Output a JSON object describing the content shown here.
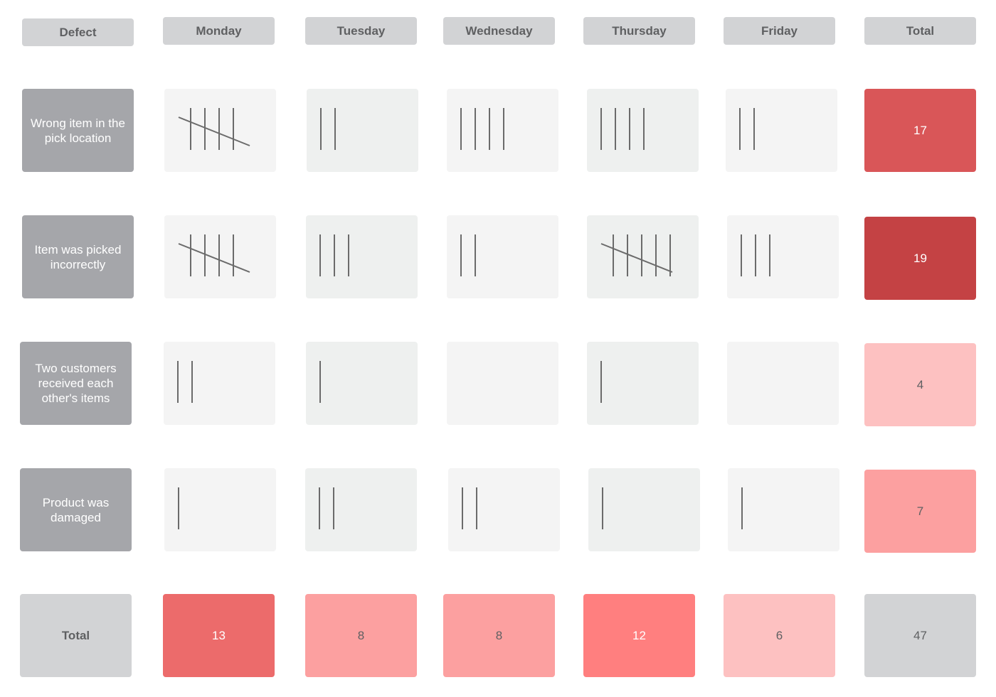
{
  "header": {
    "defect_label": "Defect",
    "days": [
      "Monday",
      "Tuesday",
      "Wednesday",
      "Thursday",
      "Friday"
    ],
    "total_label": "Total"
  },
  "rows": [
    {
      "defect": "Wrong item in the pick location",
      "counts": [
        5,
        2,
        4,
        4,
        2
      ],
      "total": "17",
      "total_color": "#d95658",
      "total_text_color": "#ffffff"
    },
    {
      "defect": "Item was picked incorrectly",
      "counts": [
        5,
        3,
        2,
        6,
        3
      ],
      "total": "19",
      "total_color": "#c44244",
      "total_text_color": "#ffffff"
    },
    {
      "defect": "Two customers received each other's items",
      "counts": [
        2,
        1,
        0,
        1,
        0
      ],
      "total": "4",
      "total_color": "#fdc1c1",
      "total_text_color": "#5f6062"
    },
    {
      "defect": "Product was damaged",
      "counts": [
        1,
        2,
        2,
        1,
        1
      ],
      "total": "7",
      "total_color": "#fca0a0",
      "total_text_color": "#5f6062"
    }
  ],
  "footer": {
    "label": "Total",
    "day_totals": [
      "13",
      "8",
      "8",
      "12",
      "6"
    ],
    "day_total_colors": [
      "#ec6b6b",
      "#fca0a0",
      "#fca0a0",
      "#ff7f7f",
      "#fdc1c1"
    ],
    "day_total_text_colors": [
      "#ffffff",
      "#5f6062",
      "#5f6062",
      "#ffffff",
      "#5f6062"
    ],
    "grand_total": "47",
    "grand_total_color": "#d2d3d5",
    "grand_total_text_color": "#5f6062"
  },
  "colors": {
    "header_bg": "#d2d3d5",
    "label_bg": "#a5a6aa",
    "tally_stroke": "#6b6b6b"
  }
}
